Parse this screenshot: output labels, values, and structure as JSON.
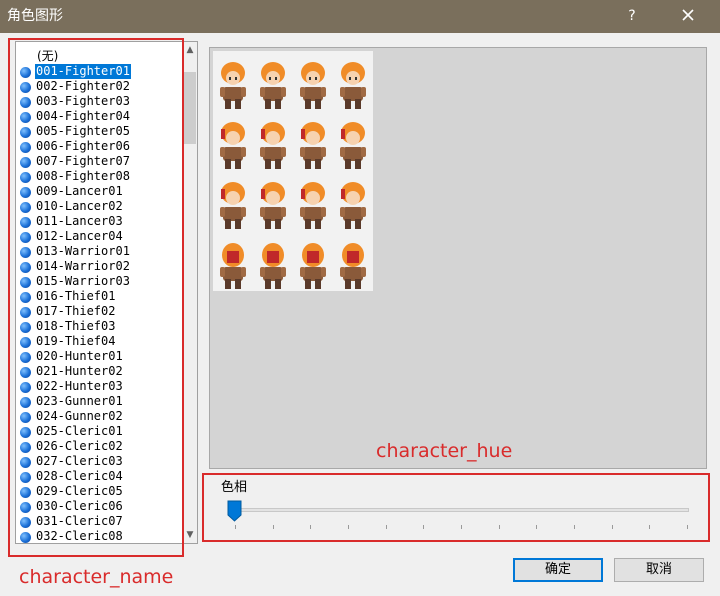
{
  "window": {
    "title": "角色图形",
    "help_label": "?",
    "close_icon": "close-icon"
  },
  "list": {
    "selected_index": 1,
    "items": [
      "(无)",
      "001-Fighter01",
      "002-Fighter02",
      "003-Fighter03",
      "004-Fighter04",
      "005-Fighter05",
      "006-Fighter06",
      "007-Fighter07",
      "008-Fighter08",
      "009-Lancer01",
      "010-Lancer02",
      "011-Lancer03",
      "012-Lancer04",
      "013-Warrior01",
      "014-Warrior02",
      "015-Warrior03",
      "016-Thief01",
      "017-Thief02",
      "018-Thief03",
      "019-Thief04",
      "020-Hunter01",
      "021-Hunter02",
      "022-Hunter03",
      "023-Gunner01",
      "024-Gunner02",
      "025-Cleric01",
      "026-Cleric02",
      "027-Cleric03",
      "028-Cleric04",
      "029-Cleric05",
      "030-Cleric06",
      "031-Cleric07",
      "032-Cleric08"
    ]
  },
  "annotations": {
    "name_label": "character_name",
    "hue_label": "character_hue"
  },
  "hue": {
    "label": "色相",
    "value": 0,
    "tick_count": 13
  },
  "buttons": {
    "ok_label": "确定",
    "cancel_label": "取消"
  },
  "colors": {
    "titlebar": "#7a6f5c",
    "selection": "#0078d7",
    "annotation": "#d92b2b",
    "hair": "#f08c28",
    "armor": "#8a5a3a"
  }
}
